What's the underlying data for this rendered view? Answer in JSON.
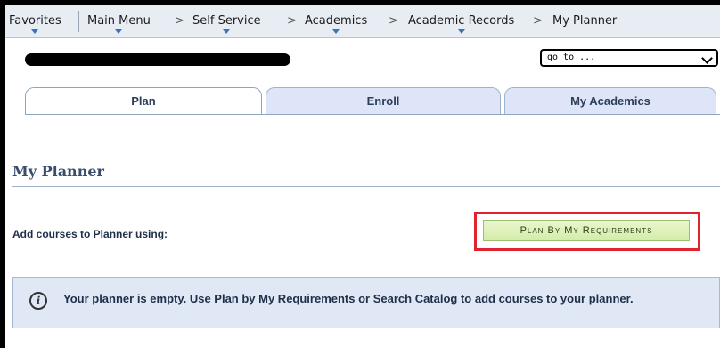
{
  "breadcrumb": {
    "items": [
      {
        "label": "Favorites"
      },
      {
        "label": "Main Menu"
      },
      {
        "label": "Self Service"
      },
      {
        "label": "Academics"
      },
      {
        "label": "Academic Records"
      },
      {
        "label": "My Planner"
      }
    ],
    "separator": ">"
  },
  "goto": {
    "value": "go to ..."
  },
  "tabs": [
    {
      "label": "Plan",
      "active": true
    },
    {
      "label": "Enroll",
      "active": false
    },
    {
      "label": "My Academics",
      "active": false
    }
  ],
  "page": {
    "title": "My Planner",
    "add_label": "Add courses to Planner using:",
    "plan_button": "Plan By My Requirements",
    "info_message": "Your planner is empty.  Use Plan by My Requirements or Search Catalog to add courses to your planner."
  },
  "icons": {
    "info": "info-icon",
    "goto_chevron": "chevron-down-icon"
  },
  "colors": {
    "highlight": "#e0242f",
    "button_bg": "#d4ecaa",
    "info_bg": "#dfe8f4",
    "tab_inactive": "#dfe5f8"
  }
}
